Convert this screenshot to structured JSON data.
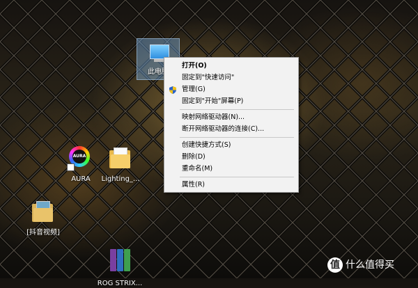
{
  "desktop": {
    "icons": [
      {
        "label": "此电脑"
      },
      {
        "label": "AURA",
        "logo_text": "AURA"
      },
      {
        "label": "Lighting_..."
      },
      {
        "label": "[抖音视频]"
      },
      {
        "label": "ROG STRIX..."
      }
    ]
  },
  "context_menu": {
    "items": [
      {
        "label": "打开(O)"
      },
      {
        "label": "固定到\"快速访问\""
      },
      {
        "label": "管理(G)",
        "icon": "shield-icon"
      },
      {
        "label": "固定到\"开始\"屏幕(P)"
      },
      {
        "label": "映射网络驱动器(N)..."
      },
      {
        "label": "断开网络驱动器的连接(C)..."
      },
      {
        "label": "创建快捷方式(S)"
      },
      {
        "label": "删除(D)"
      },
      {
        "label": "重命名(M)"
      },
      {
        "label": "属性(R)"
      }
    ]
  },
  "watermark": {
    "logo": "值",
    "text": "什么值得买"
  }
}
